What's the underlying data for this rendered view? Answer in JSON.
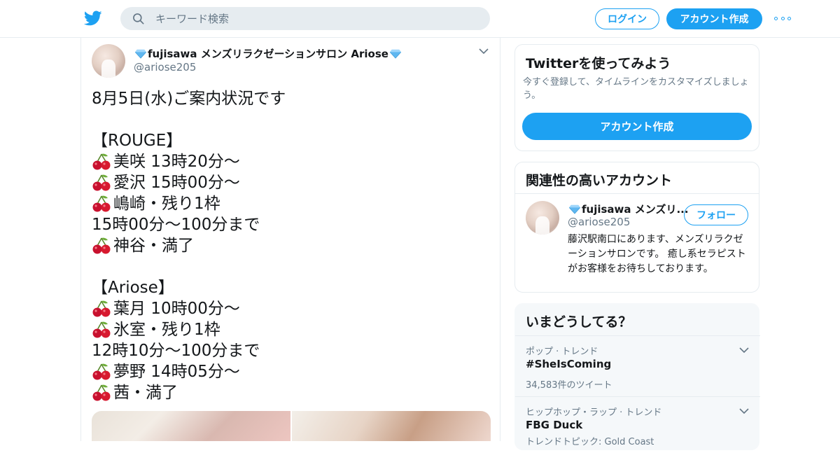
{
  "colors": {
    "accent": "#1da1f2",
    "text": "#14171a",
    "muted": "#657786",
    "border": "#e6ecf0"
  },
  "header": {
    "logo_icon": "twitter-bird-icon",
    "search_placeholder": "キーワード検索",
    "login_label": "ログイン",
    "signup_label": "アカウント作成",
    "more_icon": "more-dots-icon"
  },
  "tweet": {
    "author_name": "fujisawa メンズリラクゼーションサロン Ariose",
    "author_handle": "@ariose205",
    "lines": [
      {
        "cherry": false,
        "text": "8月5日(水)ご案内状況です"
      },
      {
        "cherry": false,
        "text": ""
      },
      {
        "cherry": false,
        "text": "【ROUGE】"
      },
      {
        "cherry": true,
        "text": "美咲 13時20分～"
      },
      {
        "cherry": true,
        "text": "愛沢 15時00分～"
      },
      {
        "cherry": true,
        "text": "嶋崎・残り1枠"
      },
      {
        "cherry": false,
        "text": "15時00分～100分まで"
      },
      {
        "cherry": true,
        "text": "神谷・満了"
      },
      {
        "cherry": false,
        "text": ""
      },
      {
        "cherry": false,
        "text": "【Ariose】"
      },
      {
        "cherry": true,
        "text": "葉月 10時00分～"
      },
      {
        "cherry": true,
        "text": "氷室・残り1枠"
      },
      {
        "cherry": false,
        "text": "12時10分～100分まで"
      },
      {
        "cherry": true,
        "text": "夢野 14時05分～"
      },
      {
        "cherry": true,
        "text": "茜・満了"
      }
    ]
  },
  "signup_card": {
    "title": "Twitterを使ってみよう",
    "subtitle": "今すぐ登録して、タイムラインをカスタマイズしましょう。",
    "button_label": "アカウント作成"
  },
  "related_card": {
    "title": "関連性の高いアカウント",
    "name": "fujisawa メンズリ...",
    "handle": "@ariose205",
    "follow_label": "フォロー",
    "bio": "藤沢駅南口にあります、メンズリラクゼーションサロンです。 癒し系セラピストがお客様をお待ちしております。"
  },
  "trends_card": {
    "title": "いまどうしてる？",
    "trends": [
      {
        "meta": "ポップ · トレンド",
        "name": "#SheIsComing",
        "count": "34,583件のツイート"
      },
      {
        "meta": "ヒップホップ・ラップ · トレンド",
        "name": "FBG Duck",
        "count": "トレンドトピック: Gold Coast"
      }
    ]
  }
}
